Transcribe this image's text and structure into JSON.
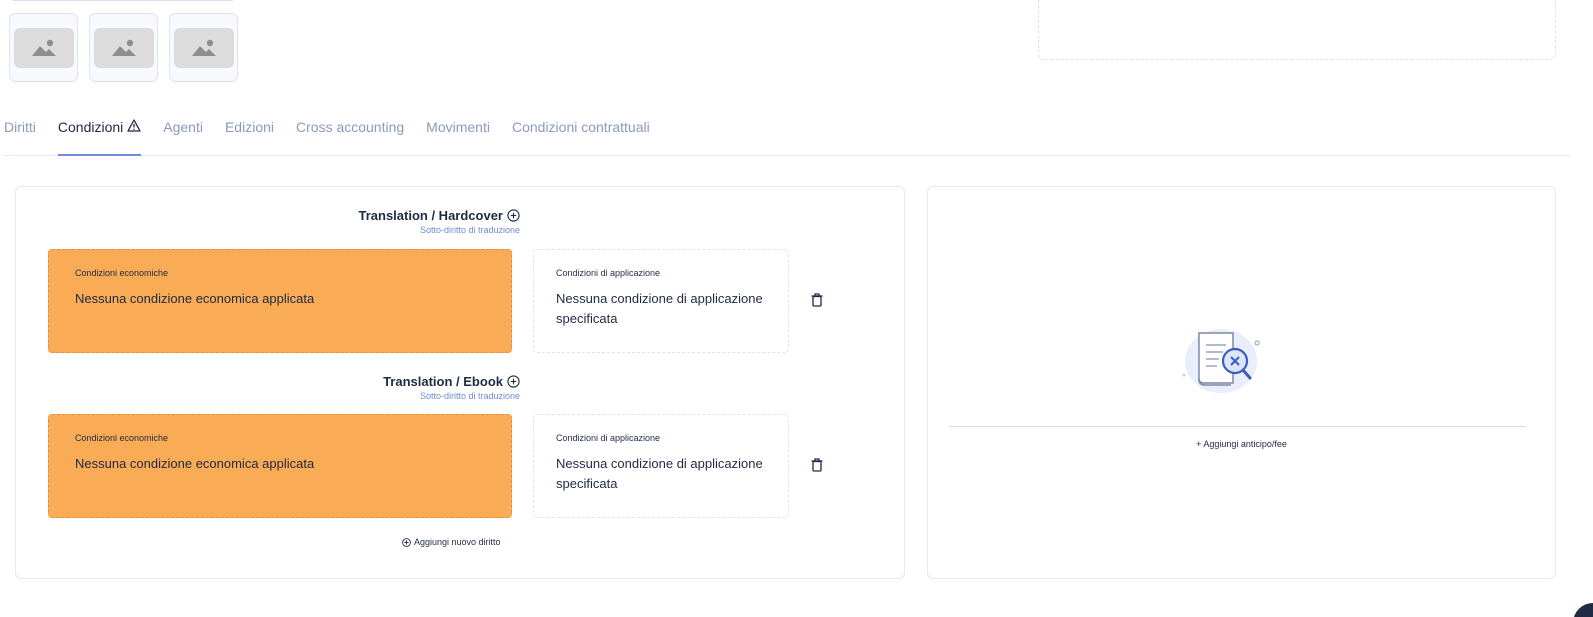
{
  "tabs": [
    {
      "label": "Diritti",
      "active": false
    },
    {
      "label": "Condizioni",
      "active": true
    },
    {
      "label": "Agenti",
      "active": false
    },
    {
      "label": "Edizioni",
      "active": false
    },
    {
      "label": "Cross accounting",
      "active": false
    },
    {
      "label": "Movimenti",
      "active": false
    },
    {
      "label": "Condizioni contrattuali",
      "active": false
    }
  ],
  "groups": [
    {
      "title": "Translation / Hardcover",
      "subtitle": "Sotto-diritto di traduzione",
      "econ_label": "Condizioni economiche",
      "econ_text": "Nessuna condizione economica applicata",
      "app_label": "Condizioni di applicazione",
      "app_text": "Nessuna condizione di applicazione specificata"
    },
    {
      "title": "Translation / Ebook",
      "subtitle": "Sotto-diritto di traduzione",
      "econ_label": "Condizioni economiche",
      "econ_text": "Nessuna condizione economica applicata",
      "app_label": "Condizioni di applicazione",
      "app_text": "Nessuna condizione di applicazione specificata"
    }
  ],
  "add_right_label": "Aggiungi nuovo diritto",
  "add_fee_label": "+ Aggiungi anticipo/fee",
  "colors": {
    "econ_bg": "#f9ab55",
    "accent": "#6f8bd9",
    "muted": "#8a9bbd"
  }
}
